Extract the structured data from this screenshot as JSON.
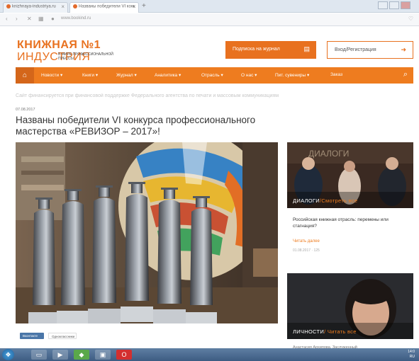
{
  "browser": {
    "tabs": [
      {
        "label": "knizhnaya-industriya.ru",
        "active": false
      },
      {
        "label": "Названы победители VI конк",
        "active": true
      }
    ],
    "url": "www.bookind.ru"
  },
  "site": {
    "logo_line1": "КНИЖНАЯ №1",
    "logo_line2": "ИНДУСТРИЯ",
    "logo_tagline": "В МИРЕ ПРОФЕССИОНАЛЬНОЙ ПРЕССЫ",
    "subscribe_label": "Подписка на журнал",
    "login_label": "Вход/Регистрация"
  },
  "nav": {
    "items": [
      "Новости",
      "Книги",
      "Журнал",
      "Аналитика",
      "Отрасль",
      "О нас",
      "Пит. сувениры",
      "Заказ"
    ]
  },
  "support_line": "Сайт финансируется при финансовой поддержке Федерального агентства по печати и массовым коммуникациям",
  "article": {
    "date": "07.08.2017",
    "title_line1": "Названы победители VI конкурса профессионального",
    "title_line2": "мастерства «РЕВИЗОР – 2017»!"
  },
  "share": {
    "vk": "Вконтакте",
    "ok": "Одноклассники"
  },
  "sidebar": {
    "card1_caption": "ДИАЛОГИ",
    "card1_more": "/Смотреть все",
    "card1_title": "Российская книжная отрасль: перемены или стагнация?",
    "card1_read": "Читать далее",
    "card1_meta": "01.08.2017 · 125",
    "card2_caption": "ЛИЧНОСТИ",
    "card2_more": "/ Читать все",
    "card2_bottom": "Анастасия Архипова. Заслуженный"
  },
  "taskbar": {
    "time": "14:0",
    "lang": "RU"
  },
  "colors": {
    "brand": "#e8711f",
    "nav": "#ee7c1f"
  }
}
